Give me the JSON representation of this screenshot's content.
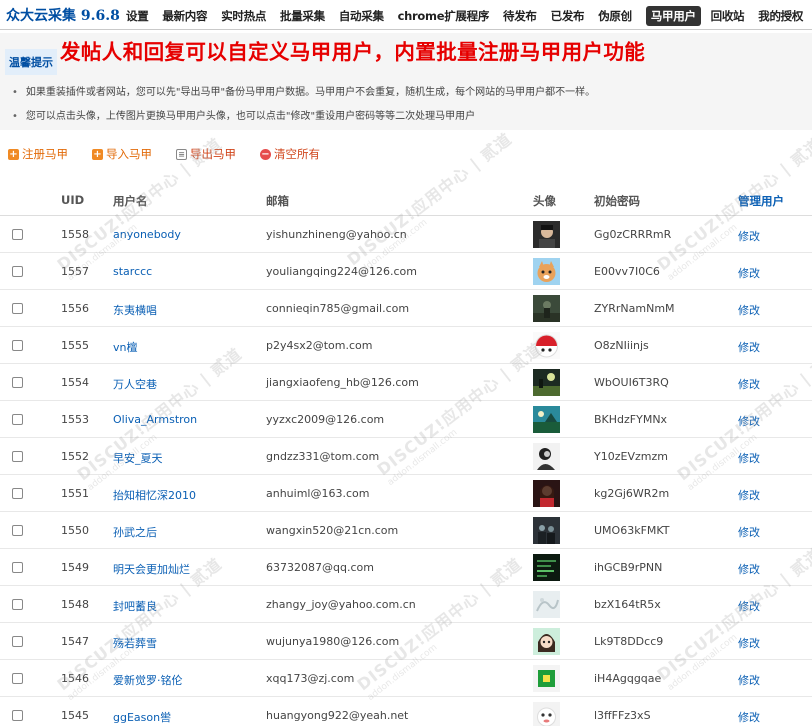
{
  "app": {
    "brand": "众大云采集 9.6.8"
  },
  "nav": [
    {
      "label": "设置",
      "active": false
    },
    {
      "label": "最新内容",
      "active": false
    },
    {
      "label": "实时热点",
      "active": false
    },
    {
      "label": "批量采集",
      "active": false
    },
    {
      "label": "自动采集",
      "active": false
    },
    {
      "label": "chrome扩展程序",
      "active": false
    },
    {
      "label": "待发布",
      "active": false
    },
    {
      "label": "已发布",
      "active": false
    },
    {
      "label": "伪原创",
      "active": false
    },
    {
      "label": "马甲用户",
      "active": true
    },
    {
      "label": "回收站",
      "active": false
    },
    {
      "label": "我的授权",
      "active": false
    }
  ],
  "tips": {
    "label": "温馨提示",
    "headline": "发帖人和回复可以自定义马甲用户，内置批量注册马甲用户功能",
    "lines": [
      "如果重装插件或者网站，您可以先\"导出马甲\"备份马甲用户数据。马甲用户不会重复，随机生成，每个网站的马甲用户都不一样。",
      "您可以点击头像，上传图片更换马甲用户头像，也可以点击\"修改\"重设用户密码等等二次处理马甲用户"
    ]
  },
  "toolbar": {
    "register": "注册马甲",
    "import": "导入马甲",
    "export": "导出马甲",
    "clear": "清空所有"
  },
  "table": {
    "headers": {
      "uid": "UID",
      "name": "用户名",
      "email": "邮箱",
      "avatar": "头像",
      "password": "初始密码",
      "manage": "管理用户"
    },
    "edit_label": "修改",
    "rows": [
      {
        "uid": "1558",
        "name": "anyonebody",
        "email": "yishunzhineng@yahoo.cn",
        "password": "Gg0zCRRRmR",
        "avatar": "dark-portrait"
      },
      {
        "uid": "1557",
        "name": "starccc",
        "email": "youliangqing224@126.com",
        "password": "E00vv7I0C6",
        "avatar": "cartoon-cat"
      },
      {
        "uid": "1556",
        "name": "东夷横唱",
        "email": "connieqin785@gmail.com",
        "password": "ZYRrNamNmM",
        "avatar": "dark-figure"
      },
      {
        "uid": "1555",
        "name": "vn檀",
        "email": "p2y4sx2@tom.com",
        "password": "O8zNIiinjs",
        "avatar": "red-hat"
      },
      {
        "uid": "1554",
        "name": "万人空巷",
        "email": "jiangxiaofeng_hb@126.com",
        "password": "WbOUI6T3RQ",
        "avatar": "night-scene"
      },
      {
        "uid": "1553",
        "name": "Oliva_Armstron",
        "email": "yyzxc2009@126.com",
        "password": "BKHdzFYMNx",
        "avatar": "teal-landscape"
      },
      {
        "uid": "1552",
        "name": "早安_夏天",
        "email": "gndzz331@tom.com",
        "password": "Y10zEVzmzm",
        "avatar": "bw-portrait"
      },
      {
        "uid": "1551",
        "name": "抬知相忆深2010",
        "email": "anhuiml@163.com",
        "password": "kg2Gj6WR2m",
        "avatar": "girl-red"
      },
      {
        "uid": "1550",
        "name": "孙武之后",
        "email": "wangxin520@21cn.com",
        "password": "UMO63kFMKT",
        "avatar": "dark-group"
      },
      {
        "uid": "1549",
        "name": "明天会更加灿烂",
        "email": "63732087@qq.com",
        "password": "ihGCB9rPNN",
        "avatar": "green-text"
      },
      {
        "uid": "1548",
        "name": "封吧蓄良",
        "email": "zhangy_joy@yahoo.com.cn",
        "password": "bzX164tR5x",
        "avatar": "light-sketch"
      },
      {
        "uid": "1547",
        "name": "殇若葬雪",
        "email": "wujunya1980@126.com",
        "password": "Lk9T8DDcc9",
        "avatar": "anime-girl"
      },
      {
        "uid": "1546",
        "name": "爱新觉罗·铭伦",
        "email": "xqq173@zj.com",
        "password": "iH4Agqgqae",
        "avatar": "green-square"
      },
      {
        "uid": "1545",
        "name": "ggEason喾",
        "email": "huangyong922@yeah.net",
        "password": "l3ffFFz3xS",
        "avatar": "white-mascot"
      }
    ]
  },
  "watermark": {
    "main": "DISCUZ!应用中心 | 贰道",
    "sub": "addon.dismall.com"
  }
}
